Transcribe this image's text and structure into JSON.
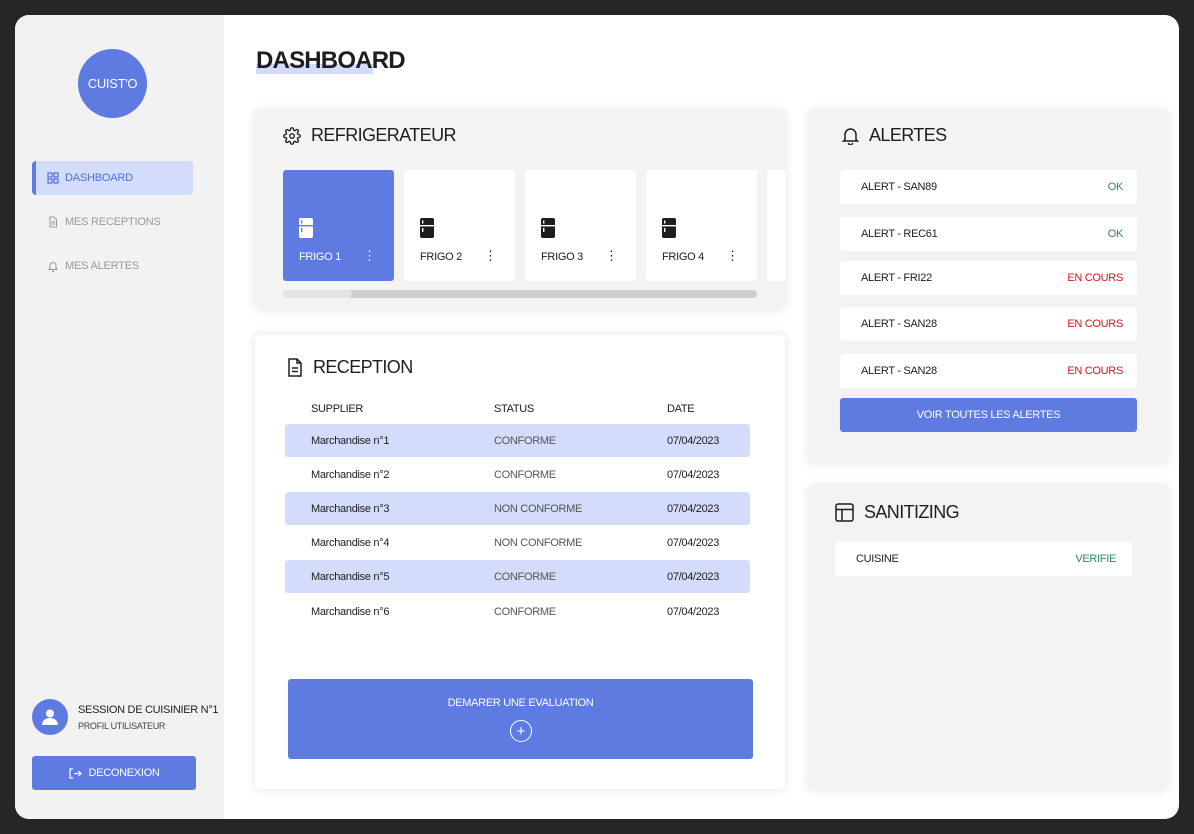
{
  "sidebar": {
    "logo": "CUIST'O",
    "nav": [
      {
        "label": "DASHBOARD"
      },
      {
        "label": "MES RECEPTIONS"
      },
      {
        "label": "MES ALERTES"
      }
    ],
    "profile": {
      "name": "SESSION DE CUISINIER N°1",
      "subtitle": "PROFIL UTILISATEUR"
    },
    "logout_label": "DECONEXION"
  },
  "page_title": "DASHBOARD",
  "refrigerator": {
    "title": "REFRIGERATEUR",
    "fridges": [
      {
        "name": "FRIGO 1"
      },
      {
        "name": "FRIGO 2"
      },
      {
        "name": "FRIGO 3"
      },
      {
        "name": "FRIGO 4"
      }
    ]
  },
  "reception": {
    "title": "RECEPTION",
    "columns": [
      "SUPPLIER",
      "STATUS",
      "DATE"
    ],
    "rows": [
      {
        "supplier": "Marchandise n°1",
        "status": "CONFORME",
        "date": "07/04/2023"
      },
      {
        "supplier": "Marchandise n°2",
        "status": "CONFORME",
        "date": "07/04/2023"
      },
      {
        "supplier": "Marchandise n°3",
        "status": "NON CONFORME",
        "date": "07/04/2023"
      },
      {
        "supplier": "Marchandise n°4",
        "status": "NON CONFORME",
        "date": "07/04/2023"
      },
      {
        "supplier": "Marchandise n°5",
        "status": "CONFORME",
        "date": "07/04/2023"
      },
      {
        "supplier": "Marchandise n°6",
        "status": "CONFORME",
        "date": "07/04/2023"
      }
    ],
    "action_label": "DEMARER UNE EVALUATION"
  },
  "alerts": {
    "title": "ALERTES",
    "items": [
      {
        "name": "ALERT - SAN89",
        "state": "OK"
      },
      {
        "name": "ALERT - REC61",
        "state": "OK"
      },
      {
        "name": "ALERT - FRI22",
        "state": "EN COURS"
      },
      {
        "name": "ALERT - SAN28",
        "state": "EN COURS"
      },
      {
        "name": "ALERT - SAN28",
        "state": "EN COURS"
      }
    ],
    "view_all_label": "VOIR TOUTES LES ALERTES"
  },
  "sanitizing": {
    "title": "SANITIZING",
    "items": [
      {
        "name": "CUISINE",
        "state": "VERIFIE"
      }
    ]
  },
  "colors": {
    "accent": "#5e7be2",
    "accent_light": "#d3dcfb",
    "ok": "#2e8b57",
    "pending": "#d0181e"
  }
}
